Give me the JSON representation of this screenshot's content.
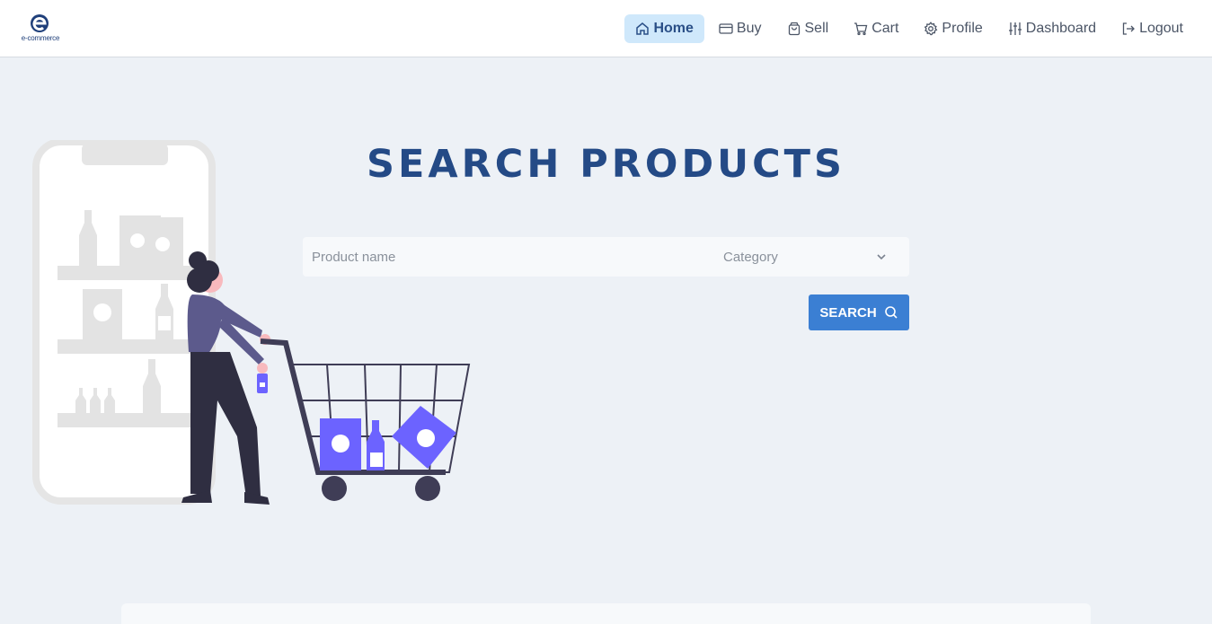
{
  "brand": {
    "logo_letter": "e",
    "logo_text": "e-commerce"
  },
  "nav": {
    "items": [
      {
        "label": "Home",
        "icon": "home-icon",
        "active": true
      },
      {
        "label": "Buy",
        "icon": "card-icon"
      },
      {
        "label": "Sell",
        "icon": "bag-icon"
      },
      {
        "label": "Cart",
        "icon": "cart-icon"
      },
      {
        "label": "Profile",
        "icon": "gear-icon"
      },
      {
        "label": "Dashboard",
        "icon": "sliders-icon"
      },
      {
        "label": "Logout",
        "icon": "logout-icon"
      }
    ]
  },
  "hero": {
    "title": "SEARCH PRODUCTS"
  },
  "search": {
    "placeholder": "Product name",
    "category_placeholder": "Category",
    "button_label": "SEARCH",
    "button_icon": "search-icon"
  },
  "colors": {
    "accent": "#3b7fd3",
    "title": "#244a86",
    "active_nav_bg": "#cfe8fb",
    "page_bg": "#edf1f6",
    "illustration_purple": "#6c63ff"
  }
}
